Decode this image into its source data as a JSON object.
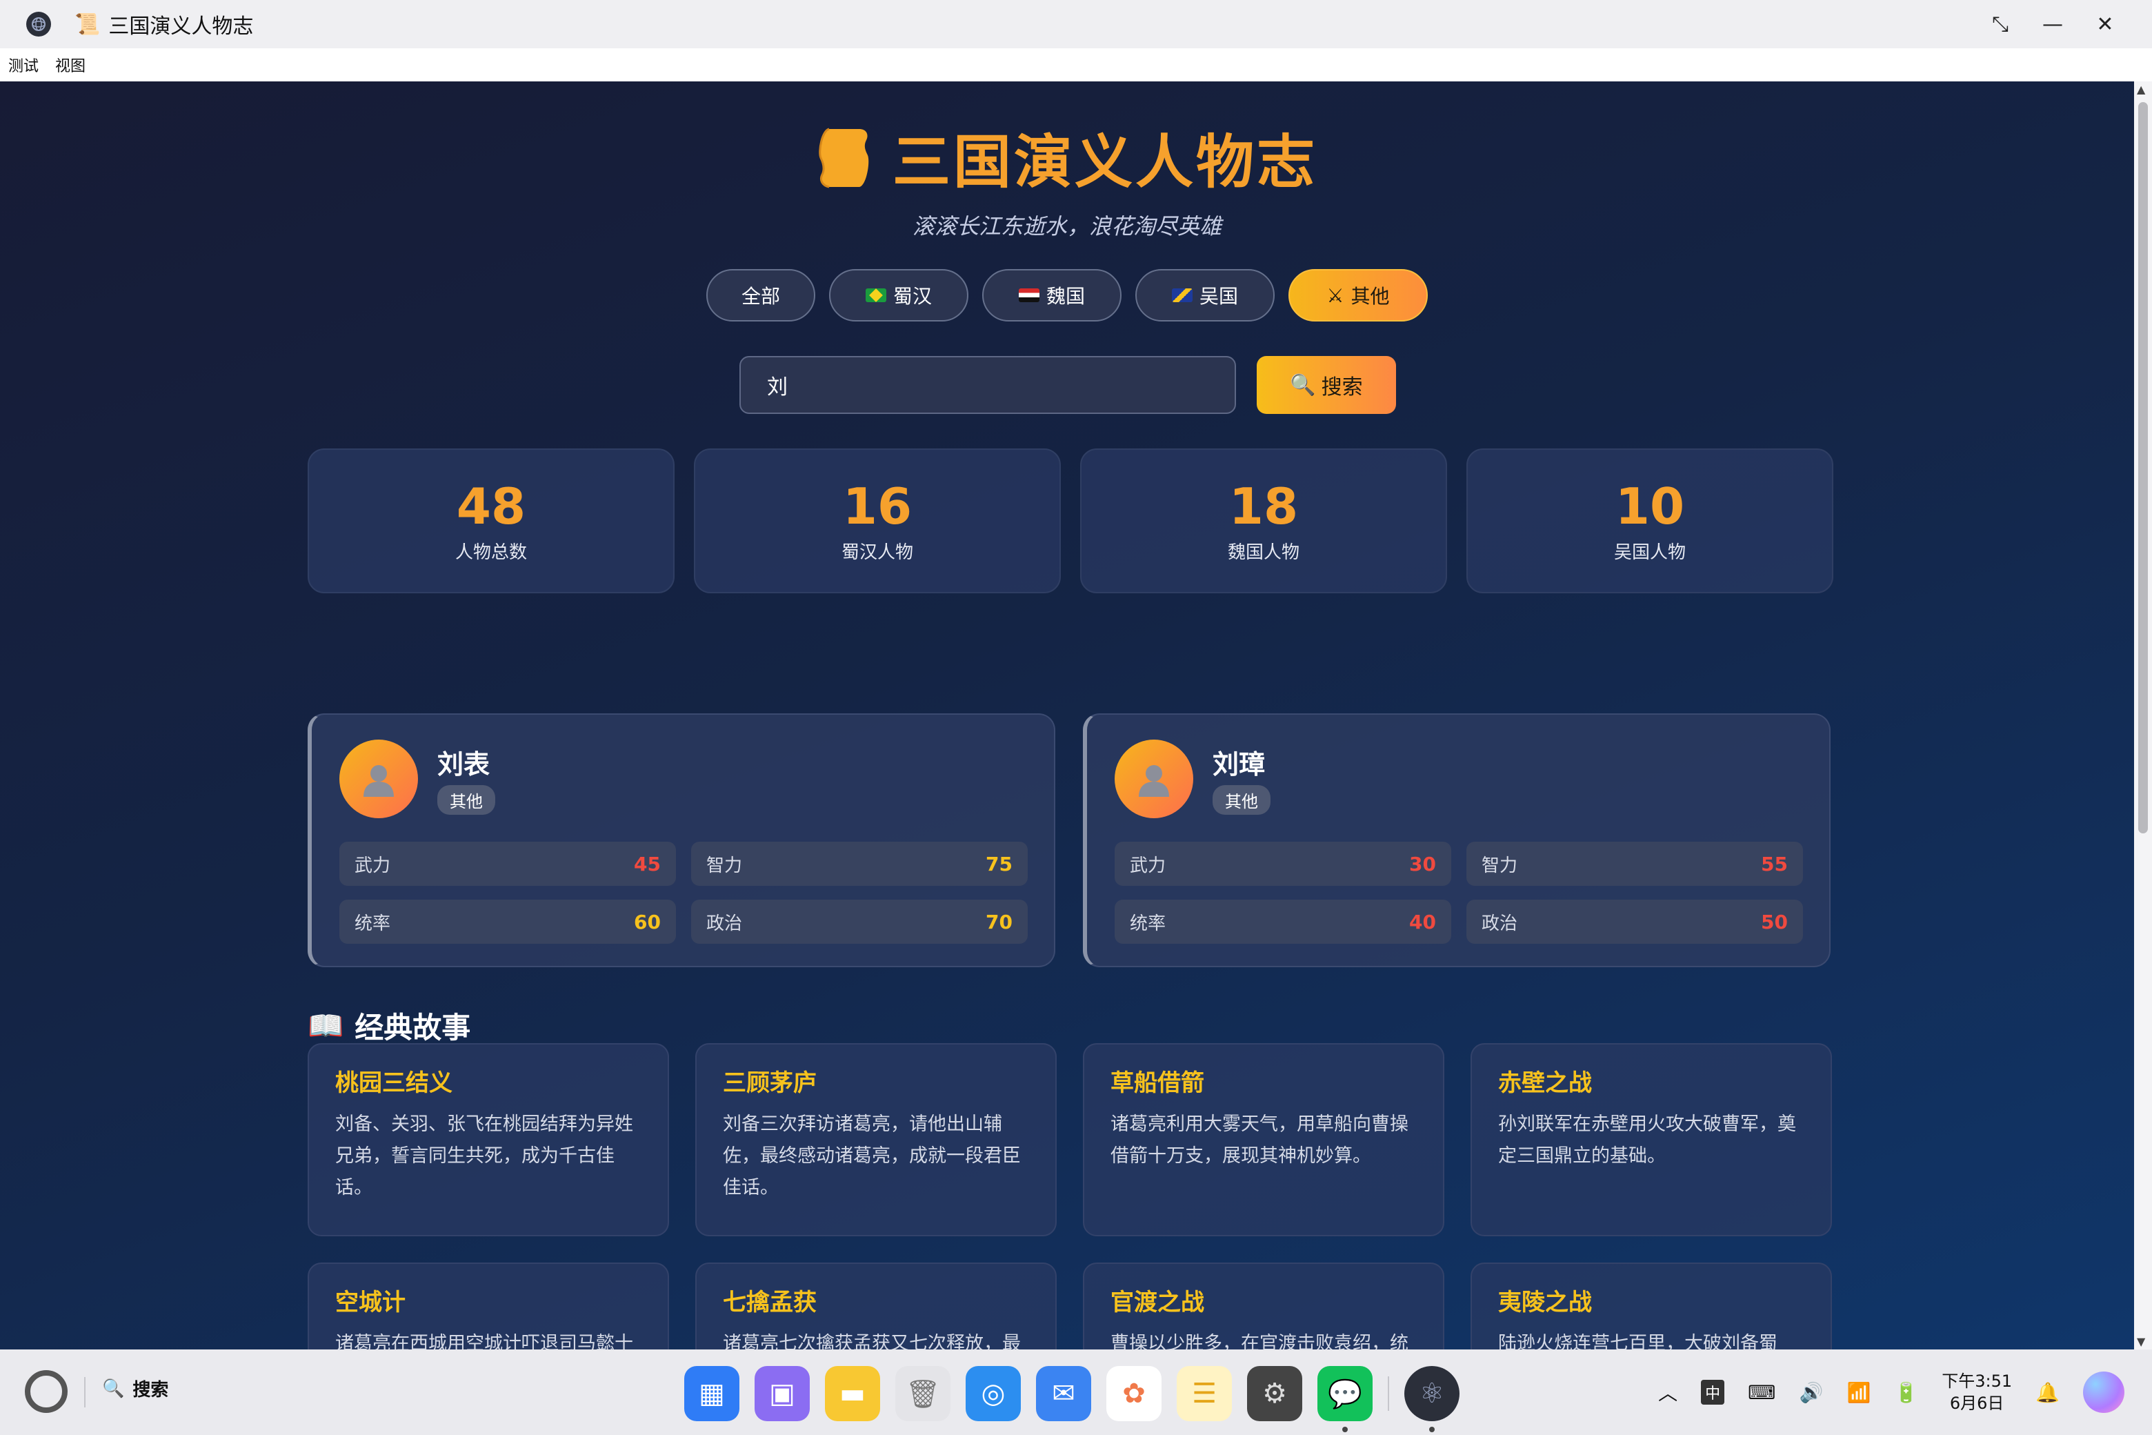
{
  "window": {
    "title": "三国演义人物志",
    "menu": [
      "测试",
      "视图"
    ]
  },
  "header": {
    "title": "三国演义人物志",
    "subtitle": "滚滚长江东逝水，浪花淘尽英雄"
  },
  "filters": [
    {
      "label": "全部",
      "icon": "",
      "active": false
    },
    {
      "label": "蜀汉",
      "icon": "brazil-flag-icon",
      "active": false
    },
    {
      "label": "魏国",
      "icon": "egypt-flag-icon",
      "active": false
    },
    {
      "label": "吴国",
      "icon": "bosnia-flag-icon",
      "active": false
    },
    {
      "label": "其他",
      "icon": "crossed-swords-icon",
      "active": true
    }
  ],
  "search": {
    "value": "刘",
    "button_label": "搜索"
  },
  "stats": [
    {
      "value": "48",
      "label": "人物总数"
    },
    {
      "value": "16",
      "label": "蜀汉人物"
    },
    {
      "value": "18",
      "label": "魏国人物"
    },
    {
      "value": "10",
      "label": "吴国人物"
    }
  ],
  "persons": [
    {
      "name": "刘表",
      "tag": "其他",
      "attrs": [
        {
          "label": "武力",
          "value": "45",
          "color": "red"
        },
        {
          "label": "智力",
          "value": "75",
          "color": "yellow"
        },
        {
          "label": "统率",
          "value": "60",
          "color": "yellow"
        },
        {
          "label": "政治",
          "value": "70",
          "color": "yellow"
        }
      ]
    },
    {
      "name": "刘璋",
      "tag": "其他",
      "attrs": [
        {
          "label": "武力",
          "value": "30",
          "color": "red"
        },
        {
          "label": "智力",
          "value": "55",
          "color": "red"
        },
        {
          "label": "统率",
          "value": "40",
          "color": "red"
        },
        {
          "label": "政治",
          "value": "50",
          "color": "red"
        }
      ]
    }
  ],
  "stories_section": {
    "title": "经典故事"
  },
  "stories": [
    {
      "title": "桃园三结义",
      "desc": "刘备、关羽、张飞在桃园结拜为异姓兄弟，誓言同生共死，成为千古佳话。"
    },
    {
      "title": "三顾茅庐",
      "desc": "刘备三次拜访诸葛亮，请他出山辅佐，最终感动诸葛亮，成就一段君臣佳话。"
    },
    {
      "title": "草船借箭",
      "desc": "诸葛亮利用大雾天气，用草船向曹操借箭十万支，展现其神机妙算。"
    },
    {
      "title": "赤壁之战",
      "desc": "孙刘联军在赤壁用火攻大破曹军，奠定三国鼎立的基础。"
    },
    {
      "title": "空城计",
      "desc": "诸葛亮在西城用空城计吓退司马懿十五万大军，成为千古绝唱。"
    },
    {
      "title": "七擒孟获",
      "desc": "诸葛亮七次擒获孟获又七次释放，最终使其心悦诚服，平定南方。"
    },
    {
      "title": "官渡之战",
      "desc": "曹操以少胜多，在官渡击败袁绍，统一北方。"
    },
    {
      "title": "夷陵之战",
      "desc": "陆逊火烧连营七百里，大破刘备蜀军，巩固东吴地位。"
    }
  ],
  "taskbar": {
    "search_label": "搜索",
    "clock_time": "下午3:51",
    "clock_date": "6月6日",
    "ime": "中"
  },
  "colors": {
    "accent": "#f6a12d",
    "gold": "#f7c21d",
    "red": "#f04a3f",
    "bg_dark": "#171b35"
  }
}
